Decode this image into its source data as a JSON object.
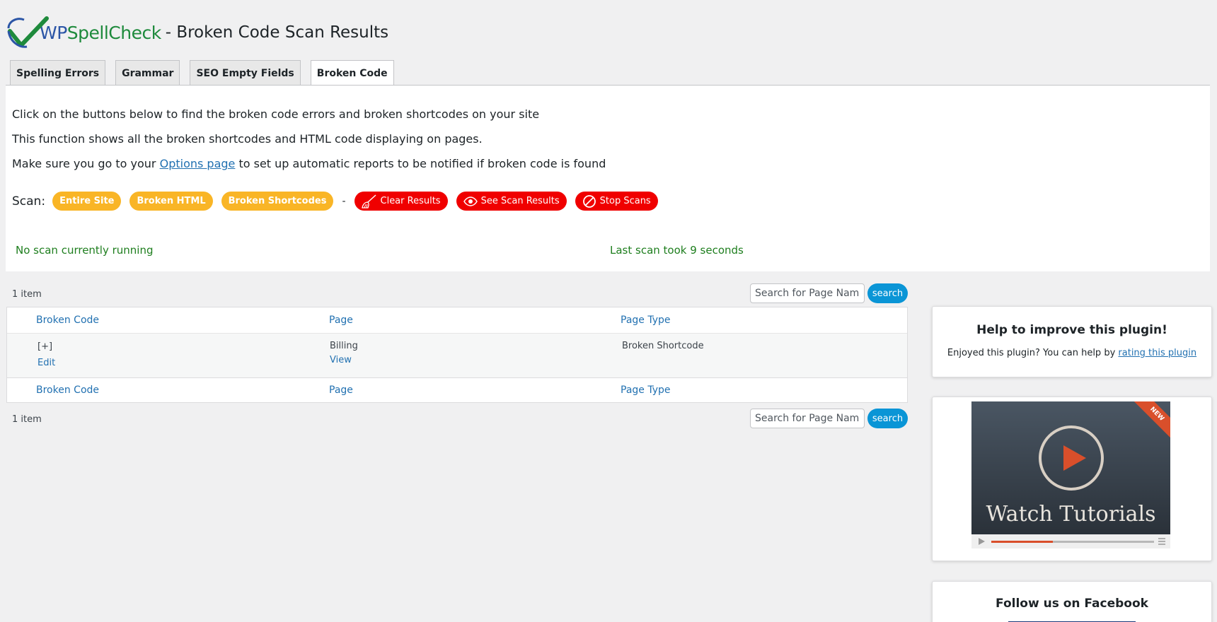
{
  "header": {
    "logo_wp": "WP",
    "logo_sc": "SpellCheck",
    "title": "- Broken Code Scan Results"
  },
  "tabs": [
    {
      "label": "Spelling Errors",
      "active": false
    },
    {
      "label": "Grammar",
      "active": false
    },
    {
      "label": "SEO Empty Fields",
      "active": false
    },
    {
      "label": "Broken Code",
      "active": true
    }
  ],
  "intro": {
    "line1": "Click on the buttons below to find the broken code errors and broken shortcodes on your site",
    "line2": "This function shows all the broken shortcodes and HTML code displaying on pages.",
    "line3_before": "Make sure you go to your ",
    "line3_link": "Options page",
    "line3_after": " to set up automatic reports to be notified if broken code is found"
  },
  "scan": {
    "label": "Scan:",
    "entire_site": "Entire Site",
    "broken_html": "Broken HTML",
    "broken_shortcodes": "Broken Shortcodes",
    "separator": "-",
    "clear_results": "Clear Results",
    "see_results": "See Scan Results",
    "stop_scans": "Stop Scans"
  },
  "status": {
    "running": "No scan currently running",
    "last": "Last scan took 9 seconds"
  },
  "table": {
    "count_top": "1 item",
    "count_bottom": "1 item",
    "search_placeholder": "Search for Page Name",
    "search_button": "search",
    "columns": [
      "Broken Code",
      "Page",
      "Page Type"
    ],
    "rows": [
      {
        "code": "[+]",
        "edit": "Edit",
        "page": "Billing",
        "view": "View",
        "page_type": "Broken Shortcode"
      }
    ]
  },
  "sidebar": {
    "help_title": "Help to improve this plugin!",
    "help_text_before": "Enjoyed this plugin? You can help by ",
    "help_link": "rating this plugin",
    "video_title": "Watch Tutorials",
    "video_badge": "NEW",
    "facebook_title": "Follow us on Facebook"
  },
  "colors": {
    "orange": "#f9b526",
    "red": "#f00000",
    "link": "#2271b1",
    "status_green": "#1e7e1e"
  }
}
